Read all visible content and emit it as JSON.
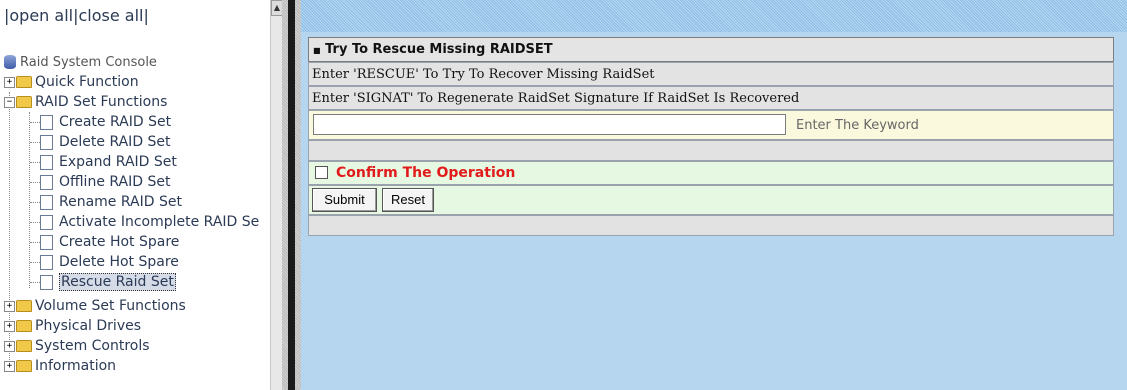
{
  "nav": {
    "open_all": "open all",
    "close_all": "close all",
    "separator": "|",
    "tree": {
      "root": "Raid System Console",
      "quick_function": "Quick Function",
      "raid_set_functions": "RAID Set Functions",
      "raid_items": [
        "Create RAID Set",
        "Delete RAID Set",
        "Expand RAID Set",
        "Offline RAID Set",
        "Rename RAID Set",
        "Activate Incomplete RAID Se",
        "Create Hot Spare",
        "Delete Hot Spare",
        "Rescue Raid Set"
      ],
      "volume_set_functions": "Volume Set Functions",
      "physical_drives": "Physical Drives",
      "system_controls": "System Controls",
      "information": "Information"
    },
    "expand_glyph": "⊞",
    "collapse_glyph": "⊟"
  },
  "form": {
    "title_bullet": "■",
    "title": "Try To Rescue Missing RAIDSET",
    "info_rescue": "Enter 'RESCUE' To Try To Recover Missing RaidSet",
    "info_signat": "Enter 'SIGNAT' To Regenerate RaidSet Signature If RaidSet Is Recovered",
    "keyword_value": "",
    "keyword_hint": "Enter The Keyword",
    "confirm_label": "Confirm The Operation",
    "submit_label": "Submit",
    "reset_label": "Reset"
  },
  "colors": {
    "main_bg": "#b6d5ee",
    "confirm_text": "#e11b1b",
    "input_row_bg": "#fbf9dd",
    "confirm_row_bg": "#e6f8e2"
  }
}
